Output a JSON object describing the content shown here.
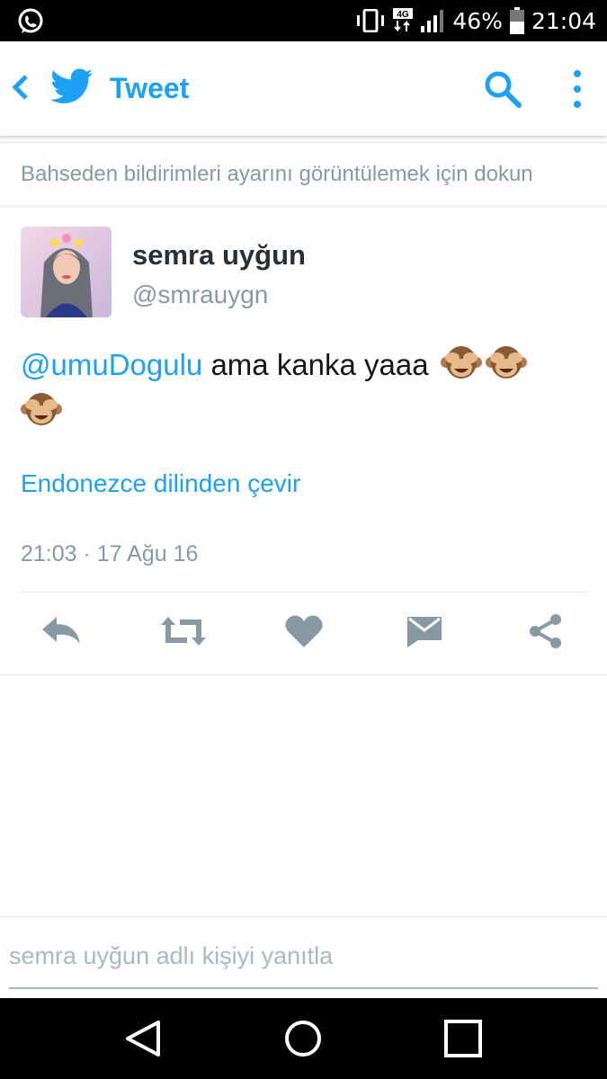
{
  "status_bar": {
    "battery": "46%",
    "time": "21:04",
    "network": "4G",
    "icons": [
      "whatsapp-icon",
      "vibrate-icon",
      "network-4g-icon",
      "signal-icon",
      "battery-icon"
    ]
  },
  "app_bar": {
    "title": "Tweet",
    "icons": [
      "back-icon",
      "twitter-bird-icon",
      "search-icon",
      "more-vert-icon"
    ],
    "accent_color": "#1da1f2"
  },
  "notice": "Bahseden bildirimleri ayarını görüntülemek için dokun",
  "tweet": {
    "author_name": "semra uyğun",
    "author_handle": "@smrauygn",
    "mention": "@umuDogulu",
    "text": " ama kanka yaaa",
    "emoji": [
      "see-no-evil-monkey-icon",
      "see-no-evil-monkey-icon",
      "see-no-evil-monkey-icon"
    ],
    "translate_link": "Endonezce dilinden çevir",
    "timestamp": "21:03 · 17 Ağu 16"
  },
  "actions": [
    "reply-icon",
    "retweet-icon",
    "like-icon",
    "direct-message-icon",
    "share-icon"
  ],
  "reply_input": {
    "placeholder": "semra uyğun adlı kişiyi yanıtla"
  },
  "nav_bar": [
    "nav-back-icon",
    "nav-home-icon",
    "nav-recents-icon"
  ],
  "colors": {
    "text_primary": "#14171a",
    "text_secondary": "#8899a6",
    "icon_gray": "#8899a6",
    "divider": "#e1e8ed"
  }
}
